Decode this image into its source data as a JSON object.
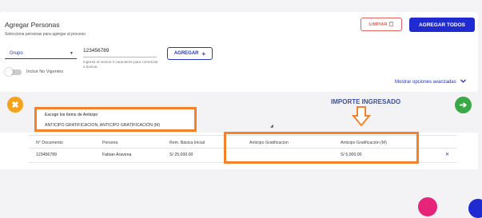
{
  "header": {
    "title": "Agregar Personas",
    "subtitle": "Selecciona personas para agregar al proceso",
    "limpiar_label": "LIMPIAR",
    "agregar_todos_label": "AGREGAR TODOS"
  },
  "filters": {
    "grupo_value": "Grupo",
    "document_value": "123456789",
    "hint": "Ingresa al menos 3 caracteres para comenzar a buscar.",
    "agregar_label": "AGREGAR",
    "toggle_label": "Incluir No Vigentes",
    "advanced_link": "Mostrar opciones avanzadas"
  },
  "anticipo": {
    "items_label": "Escoge los ítems de Anticipo",
    "items_value": "ANTICIPO GRATIFICACION, ANTICIPO GRATIFICACIÓN (M)",
    "importe_annotation": "IMPORTE INGRESADO"
  },
  "table": {
    "headers": [
      "N° Documento",
      "Persona",
      "Rem. Básica Inicial",
      "Anticipo Gratificacion",
      "Anticipo Gratificación (M)"
    ],
    "rows": [
      [
        "123456789",
        "Fabian Aravena",
        "S/ 25,000.00",
        "",
        "S/ 5,000.00"
      ]
    ]
  },
  "colors": {
    "primary": "#1f2bd1",
    "danger": "#e0625e",
    "highlight": "#f5822a",
    "cancel": "#f7a21b",
    "next": "#3aa845"
  }
}
